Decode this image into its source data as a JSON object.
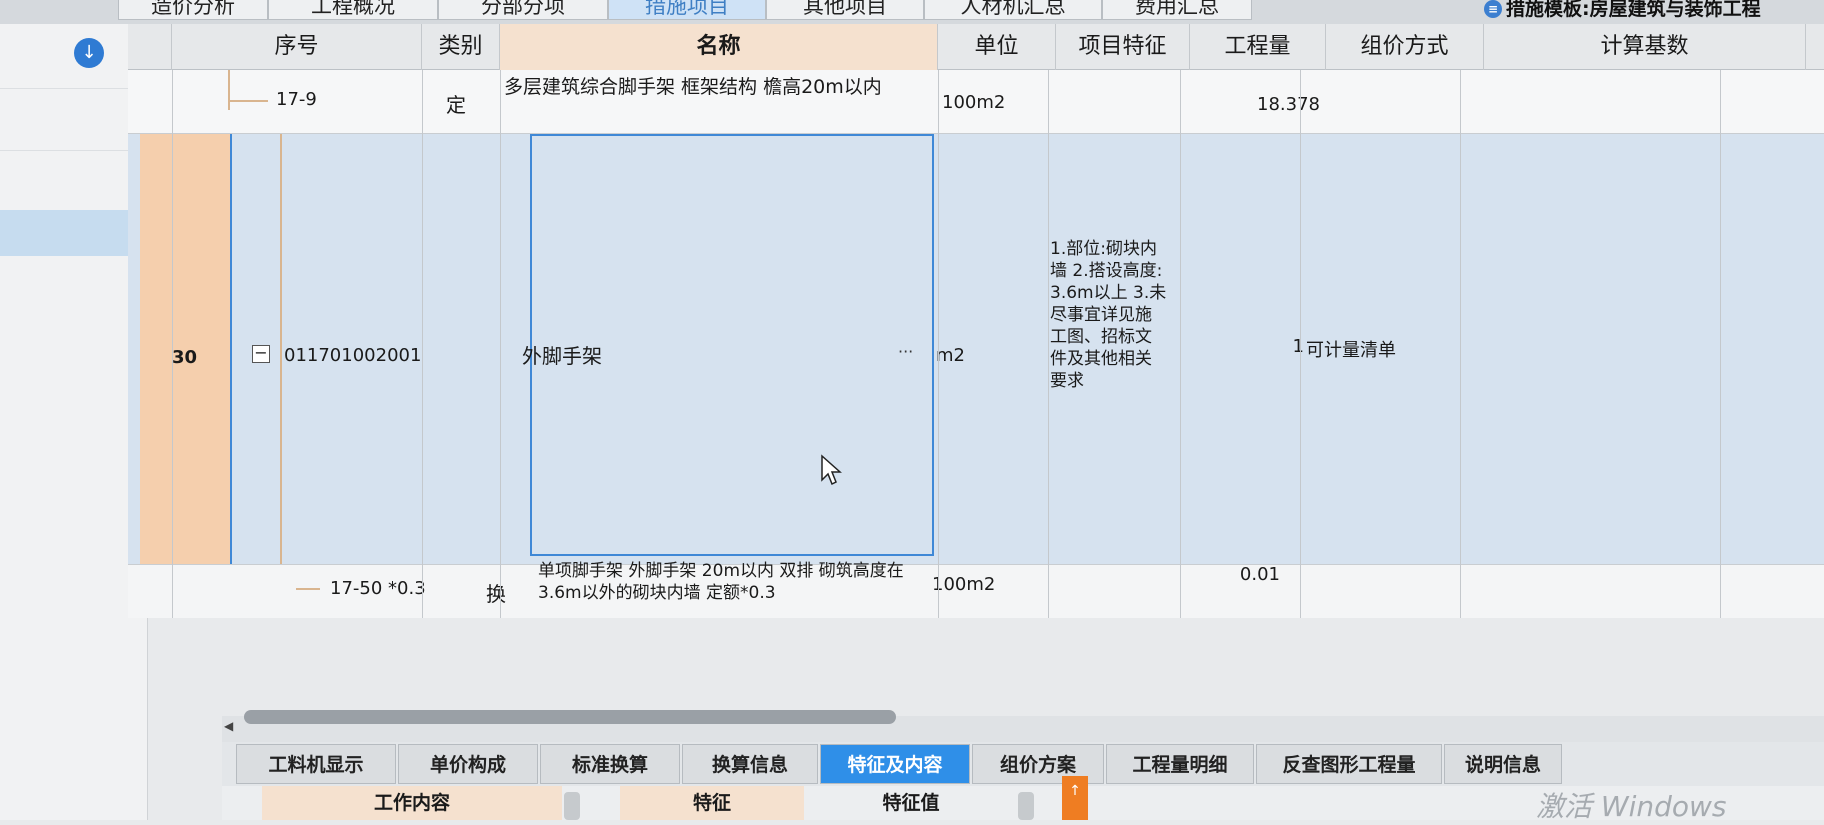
{
  "top_tabs": [
    "造价分析",
    "工程概况",
    "分部分项",
    "措施项目",
    "其他项目",
    "人材机汇总",
    "费用汇总"
  ],
  "template_label": "措施模板:房屋建筑与装饰工程",
  "columns": [
    "",
    "序号",
    "类别",
    "名称",
    "单位",
    "项目特征",
    "工程量",
    "组价方式",
    "计算基数"
  ],
  "rows": {
    "r1": {
      "code": "17-9",
      "type": "定",
      "name": "多层建筑综合脚手架 框架结构 檐高20m以内",
      "unit": "100m2",
      "quantity": "18.378"
    },
    "r2": {
      "index": "30",
      "collapse": "−",
      "code": "011701002001",
      "name": "外脚手架",
      "ellipsis": "···",
      "unit": "m2",
      "features": "1.部位:砌块内墙 2.搭设高度:3.6m以上 3.未尽事宜详见施工图、招标文件及其他相关要求",
      "quantity": "1",
      "pricing": "可计量清单"
    },
    "r3": {
      "code": "17-50 *0.3",
      "type": "换",
      "name": "单项脚手架 外脚手架 20m以内 双排 砌筑高度在3.6m以外的砌块内墙 定额*0.3",
      "unit": "100m2",
      "quantity": "0.01"
    }
  },
  "bottom_tabs": [
    "工料机显示",
    "单价构成",
    "标准换算",
    "换算信息",
    "特征及内容",
    "组价方案",
    "工程量明细",
    "反查图形工程量",
    "说明信息"
  ],
  "active_bottom_tab": "特征及内容",
  "sub_headers": {
    "work": "工作内容",
    "feature": "特征",
    "feature_value": "特征值"
  },
  "watermark": "激活 Windows",
  "accent_color": "#2f8fe8",
  "selected_row_color": "#d6e2ef",
  "highlight_color": "#f5cfad"
}
